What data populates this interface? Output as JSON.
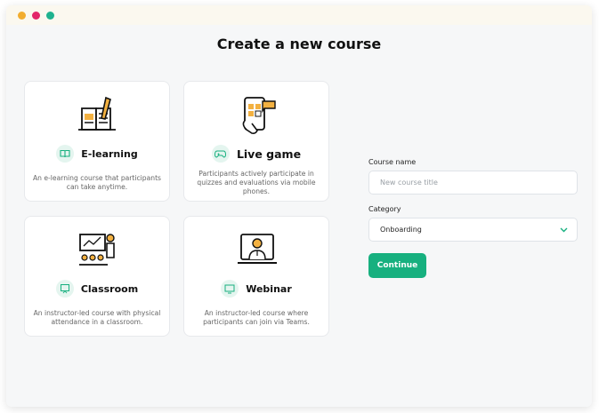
{
  "heading": "Create a new course",
  "cards": [
    {
      "title": "E-learning",
      "description": "An e-learning course that participants can take anytime.",
      "icon": "book-icon"
    },
    {
      "title": "Live game",
      "description": "Participants actively participate in quizzes and evaluations via mobile phones.",
      "icon": "gamepad-icon"
    },
    {
      "title": "Classroom",
      "description": "An instructor-led course with physical attendance in a classroom.",
      "icon": "presentation-icon"
    },
    {
      "title": "Webinar",
      "description": "An instructor-led course where participants can join via Teams.",
      "icon": "monitor-icon"
    }
  ],
  "form": {
    "course_name_label": "Course name",
    "course_name_placeholder": "New course title",
    "category_label": "Category",
    "category_value": "Onboarding",
    "continue_label": "Continue"
  },
  "colors": {
    "accent": "#17b07f",
    "window_dots": [
      "#f2ad2f",
      "#e3266a",
      "#1fb28e"
    ]
  }
}
